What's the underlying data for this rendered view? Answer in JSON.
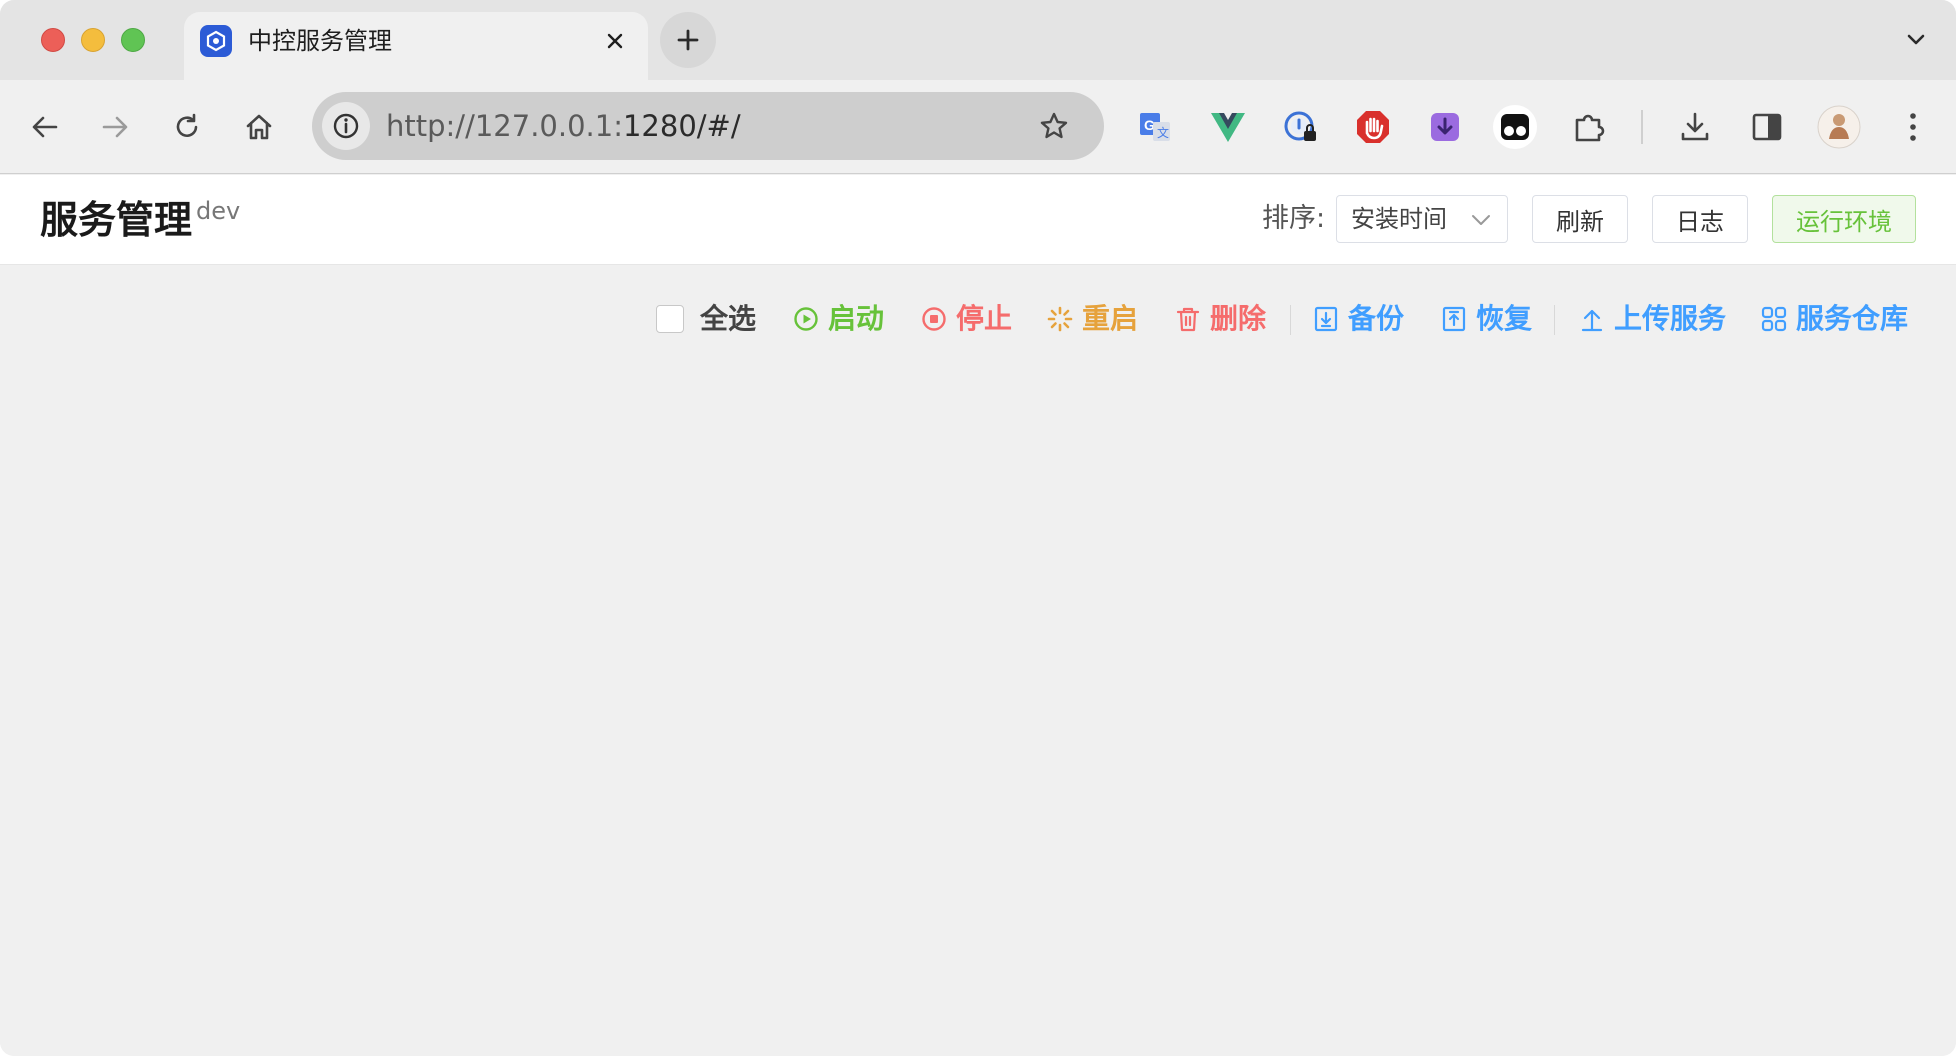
{
  "browser": {
    "tab": {
      "title": "中控服务管理",
      "favicon": "service-hexagon-icon"
    },
    "address": {
      "scheme_host": "http://127.0.0.1:",
      "port_path": "1280/#/"
    },
    "extensions": [
      "google-translate-icon",
      "vue-devtools-icon",
      "password-lock-icon",
      "adblock-hand-icon",
      "download-box-icon",
      "tampermonkey-icon",
      "extensions-puzzle-icon"
    ],
    "toolbar_icons": [
      "back-icon",
      "forward-icon",
      "reload-icon",
      "home-icon",
      "site-info-icon",
      "bookmark-star-icon",
      "downloads-icon",
      "side-panel-icon",
      "profile-avatar",
      "kebab-menu-icon"
    ]
  },
  "header": {
    "title": "服务管理",
    "env": "dev",
    "sort_label": "排序:",
    "sort_value": "安装时间",
    "refresh_label": "刷新",
    "log_label": "日志",
    "runtime_env_label": "运行环境"
  },
  "actions": {
    "select_all": "全选",
    "start": "启动",
    "stop": "停止",
    "restart": "重启",
    "delete": "删除",
    "backup": "备份",
    "restore": "恢复",
    "upload": "上传服务",
    "repository": "服务仓库"
  },
  "colors": {
    "success": "#67c23a",
    "danger": "#f56c6c",
    "warning": "#e6a23c",
    "primary": "#409eff"
  }
}
